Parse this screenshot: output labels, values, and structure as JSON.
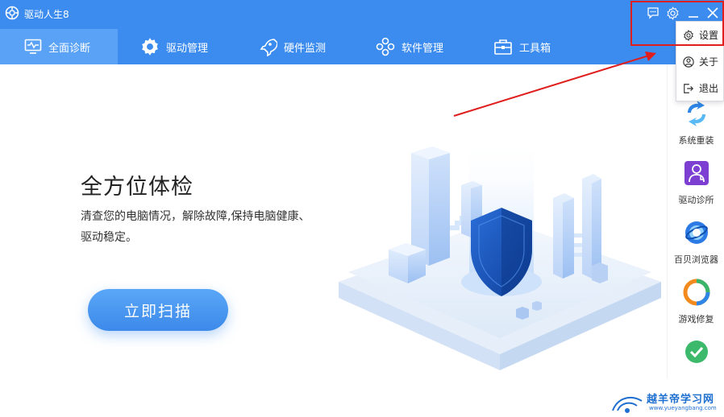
{
  "window": {
    "title": "驱动人生8"
  },
  "nav": {
    "tabs": [
      {
        "label": "全面诊断",
        "icon": "monitor-pulse-icon",
        "active": true
      },
      {
        "label": "驱动管理",
        "icon": "gear-icon",
        "active": false
      },
      {
        "label": "硬件监测",
        "icon": "rocket-icon",
        "active": false
      },
      {
        "label": "软件管理",
        "icon": "apps-icon",
        "active": false
      },
      {
        "label": "工具箱",
        "icon": "toolbox-icon",
        "active": false
      }
    ]
  },
  "hero": {
    "title": "全方位体检",
    "description": "清查您的电脑情况，解除故障,保持电脑健康、驱动稳定。",
    "scan_button": "立即扫描"
  },
  "dropdown": {
    "items": [
      {
        "label": "设置",
        "icon": "gear-icon"
      },
      {
        "label": "关于",
        "icon": "user-circle-icon"
      },
      {
        "label": "退出",
        "icon": "exit-icon"
      }
    ]
  },
  "sidebar": {
    "items": [
      {
        "label": "系统重装",
        "icon": "refresh-arrows-icon"
      },
      {
        "label": "驱动诊所",
        "icon": "doctor-icon"
      },
      {
        "label": "百贝浏览器",
        "icon": "browser-icon"
      },
      {
        "label": "游戏修复",
        "icon": "game-repair-icon"
      },
      {
        "label": "",
        "icon": "check-shield-icon"
      }
    ]
  },
  "watermark": {
    "text": "越羊帝学习网",
    "url": "www.yueyangbang.com"
  },
  "colors": {
    "accent": "#3c8cf0",
    "annotation": "#e01e1e"
  }
}
